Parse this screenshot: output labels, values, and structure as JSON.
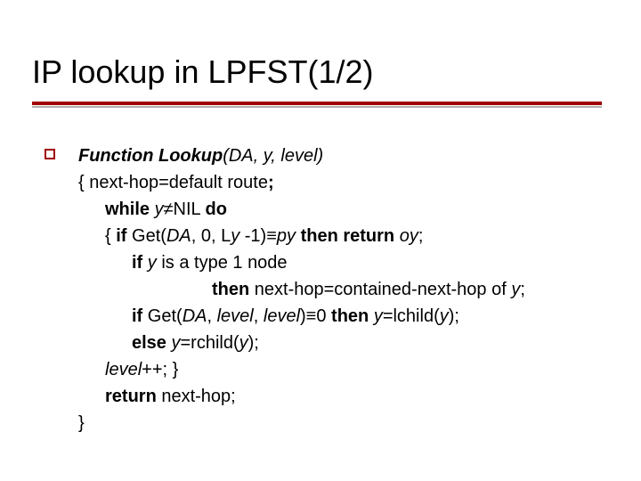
{
  "title": "IP lookup in LPFST(1/2)",
  "lines": {
    "l0a": "Function Lookup",
    "l0b": "(DA, y, level)",
    "l1a": "{ next-hop=default route",
    "l1semi": ";",
    "l2a": "while ",
    "l2b": "y",
    "l2c": "≠NIL ",
    "l2d": "do",
    "l3a": "{ ",
    "l3b": "if ",
    "l3c": "Get(",
    "l3d": "DA",
    "l3e": ", 0, L",
    "l3f": "y",
    "l3g": " -1)≡",
    "l3h": "py ",
    "l3i": "then return ",
    "l3j": "oy",
    "l3k": ";",
    "l4a": "if ",
    "l4b": "y ",
    "l4c": "is a type 1 node",
    "l5a": "then ",
    "l5b": "next-hop=contained-next-hop of ",
    "l5c": "y",
    "l5d": ";",
    "l6a": "if ",
    "l6b": "Get(",
    "l6c": "DA",
    "l6d": ", ",
    "l6e": "level",
    "l6f": ", ",
    "l6g": "level",
    "l6h": ")≡0 ",
    "l6i": "then ",
    "l6j": "y",
    "l6k": "=lchild(",
    "l6l": "y",
    "l6m": ");",
    "l7a": "else ",
    "l7b": "y",
    "l7c": "=rchild(",
    "l7d": "y",
    "l7e": ");",
    "l8a": "level",
    "l8b": "++; }",
    "l9a": "return ",
    "l9b": "next-hop;",
    "l10a": "}"
  }
}
